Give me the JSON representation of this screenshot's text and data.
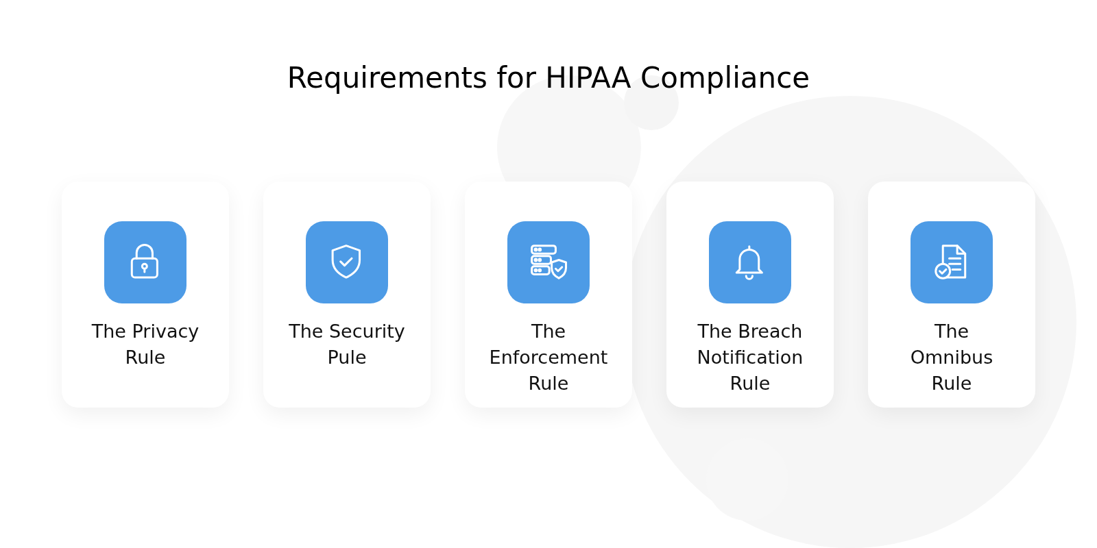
{
  "title": "Requirements for HIPAA Compliance",
  "cards": [
    {
      "lines": [
        "The Privacy",
        "Rule"
      ]
    },
    {
      "lines": [
        "The Security",
        "Pule"
      ]
    },
    {
      "lines": [
        "The",
        "Enforcement",
        "Rule"
      ]
    },
    {
      "lines": [
        "The Breach",
        "Notification",
        "Rule"
      ]
    },
    {
      "lines": [
        "The",
        "Omnibus",
        "Rule"
      ]
    }
  ]
}
